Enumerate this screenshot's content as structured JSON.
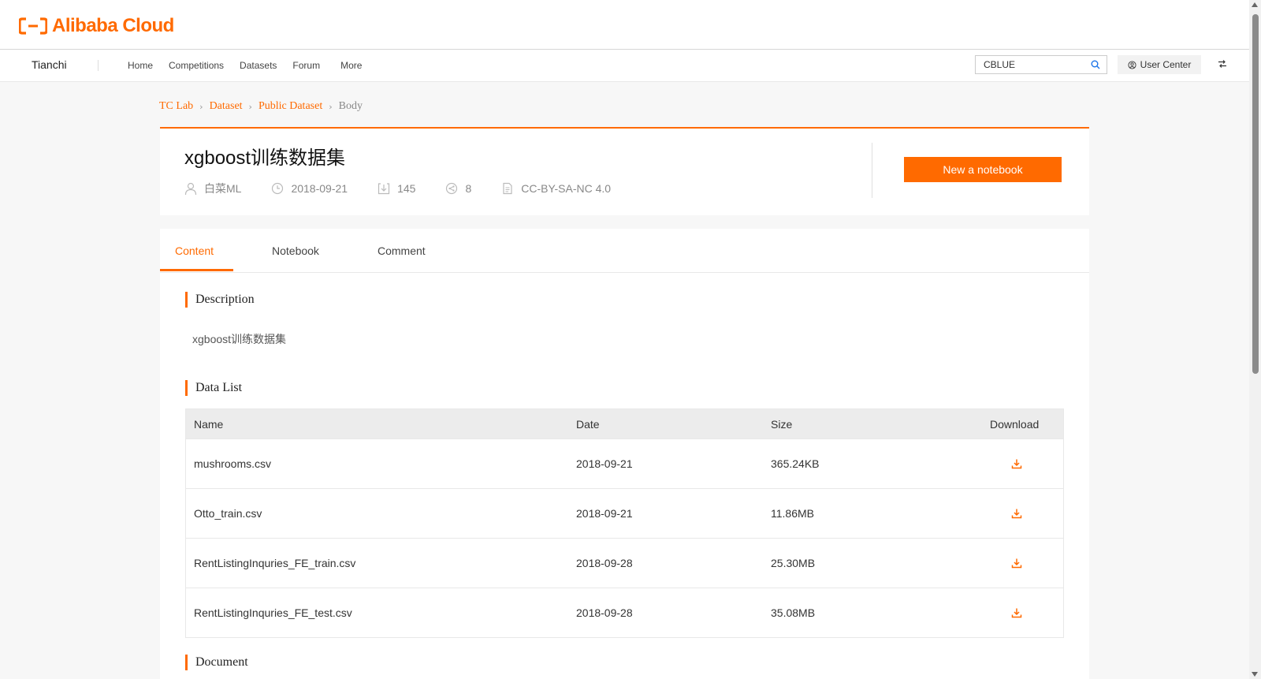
{
  "brand": {
    "logo_text": "Alibaba Cloud",
    "accent": "#ff6a00"
  },
  "nav": {
    "site": "Tianchi",
    "links": [
      "Home",
      "Competitions",
      "Datasets",
      "Forum",
      "More"
    ],
    "search_value": "CBLUE",
    "user_center": "User Center"
  },
  "breadcrumb": [
    "TC Lab",
    "Dataset",
    "Public Dataset",
    "Body"
  ],
  "dataset": {
    "title": "xgboost训练数据集",
    "author": "白菜ML",
    "date": "2018-09-21",
    "downloads": "145",
    "shares": "8",
    "license": "CC-BY-SA-NC 4.0",
    "new_notebook": "New a notebook"
  },
  "tabs": [
    "Content",
    "Notebook",
    "Comment"
  ],
  "sections": {
    "description_title": "Description",
    "description_text": "xgboost训练数据集",
    "data_list_title": "Data List",
    "document_title": "Document"
  },
  "table": {
    "headers": {
      "name": "Name",
      "date": "Date",
      "size": "Size",
      "download": "Download"
    },
    "rows": [
      {
        "name": "mushrooms.csv",
        "date": "2018-09-21",
        "size": "365.24KB"
      },
      {
        "name": "Otto_train.csv",
        "date": "2018-09-21",
        "size": "11.86MB"
      },
      {
        "name": "RentListingInquries_FE_train.csv",
        "date": "2018-09-28",
        "size": "25.30MB"
      },
      {
        "name": "RentListingInquries_FE_test.csv",
        "date": "2018-09-28",
        "size": "35.08MB"
      }
    ]
  }
}
